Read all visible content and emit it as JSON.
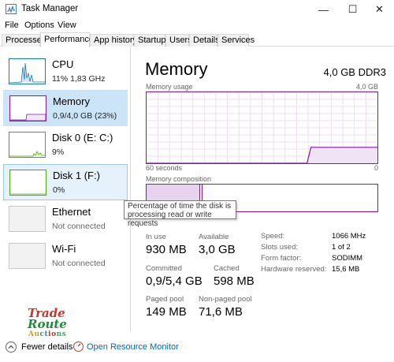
{
  "window": {
    "title": "Task Manager",
    "minimize_glyph": "—",
    "maximize_glyph": "☐",
    "close_glyph": "✕"
  },
  "menu": [
    "File",
    "Options",
    "View"
  ],
  "tabs": [
    "Processes",
    "Performance",
    "App history",
    "Startup",
    "Users",
    "Details",
    "Services"
  ],
  "active_tab": "Performance",
  "sidebar": {
    "items": [
      {
        "name": "CPU",
        "detail": "11% 1,83 GHz",
        "icon": "cpu-graph"
      },
      {
        "name": "Memory",
        "detail": "0,9/4,0 GB (23%)",
        "icon": "memory-graph"
      },
      {
        "name": "Disk 0 (E: C:)",
        "detail": "9%",
        "icon": "disk-graph"
      },
      {
        "name": "Disk 1 (F:)",
        "detail": "0%",
        "icon": "disk-graph"
      },
      {
        "name": "Ethernet",
        "detail": "Not connected",
        "icon": "network-graph"
      },
      {
        "name": "Wi-Fi",
        "detail": "Not connected",
        "icon": "network-graph"
      }
    ]
  },
  "main": {
    "title": "Memory",
    "spec": "4,0 GB DDR3",
    "usage_label": "Memory usage",
    "usage_max": "4,0 GB",
    "axis_left": "60 seconds",
    "axis_right": "0",
    "composition_label": "Memory composition",
    "stats": {
      "in_use_label": "In use",
      "in_use_value": "930 MB",
      "available_label": "Available",
      "available_value": "3,0 GB",
      "committed_label": "Committed",
      "committed_value": "0,9/5,4 GB",
      "cached_label": "Cached",
      "cached_value": "598 MB",
      "paged_label": "Paged pool",
      "paged_value": "149 MB",
      "nonpaged_label": "Non-paged pool",
      "nonpaged_value": "71,6 MB"
    },
    "details": [
      {
        "label": "Speed:",
        "value": "1066 MHz"
      },
      {
        "label": "Slots used:",
        "value": "1 of 2"
      },
      {
        "label": "Form factor:",
        "value": "SODIMM"
      },
      {
        "label": "Hardware reserved:",
        "value": "15,6 MB"
      }
    ]
  },
  "tooltip": {
    "line1": "Percentage of time the disk is",
    "line2": "processing read or write requests"
  },
  "logo": {
    "line1": "Trade",
    "line2": "Route",
    "line3": "Auctions"
  },
  "footer": {
    "fewer_details": "Fewer details",
    "resource_monitor": "Open Resource Monitor"
  },
  "colors": {
    "memory": "#8b12ae",
    "cpu": "#1178c0",
    "disk": "#4da60c",
    "selected": "#cce4f7",
    "link": "#0066cc"
  },
  "chart_data": {
    "type": "area",
    "series": [
      {
        "values": [
          0,
          0,
          0,
          0,
          0,
          0,
          0,
          0,
          0,
          0,
          0,
          0,
          0,
          0,
          0,
          0,
          0,
          0,
          0,
          0,
          0,
          0,
          0,
          0,
          0,
          0,
          0,
          0,
          0,
          0,
          0,
          0,
          0,
          0,
          0,
          0,
          0,
          0,
          0,
          0,
          0,
          0,
          0.9,
          0.9,
          0.9,
          0.9,
          0.9,
          0.9,
          0.9,
          0.9,
          0.9,
          0.9,
          0.9,
          0.9,
          0.9,
          0.9,
          0.9,
          0.9,
          0.9,
          0.9
        ]
      }
    ],
    "xlabel": "60 seconds",
    "ylim": [
      0,
      4
    ],
    "grid": true
  }
}
